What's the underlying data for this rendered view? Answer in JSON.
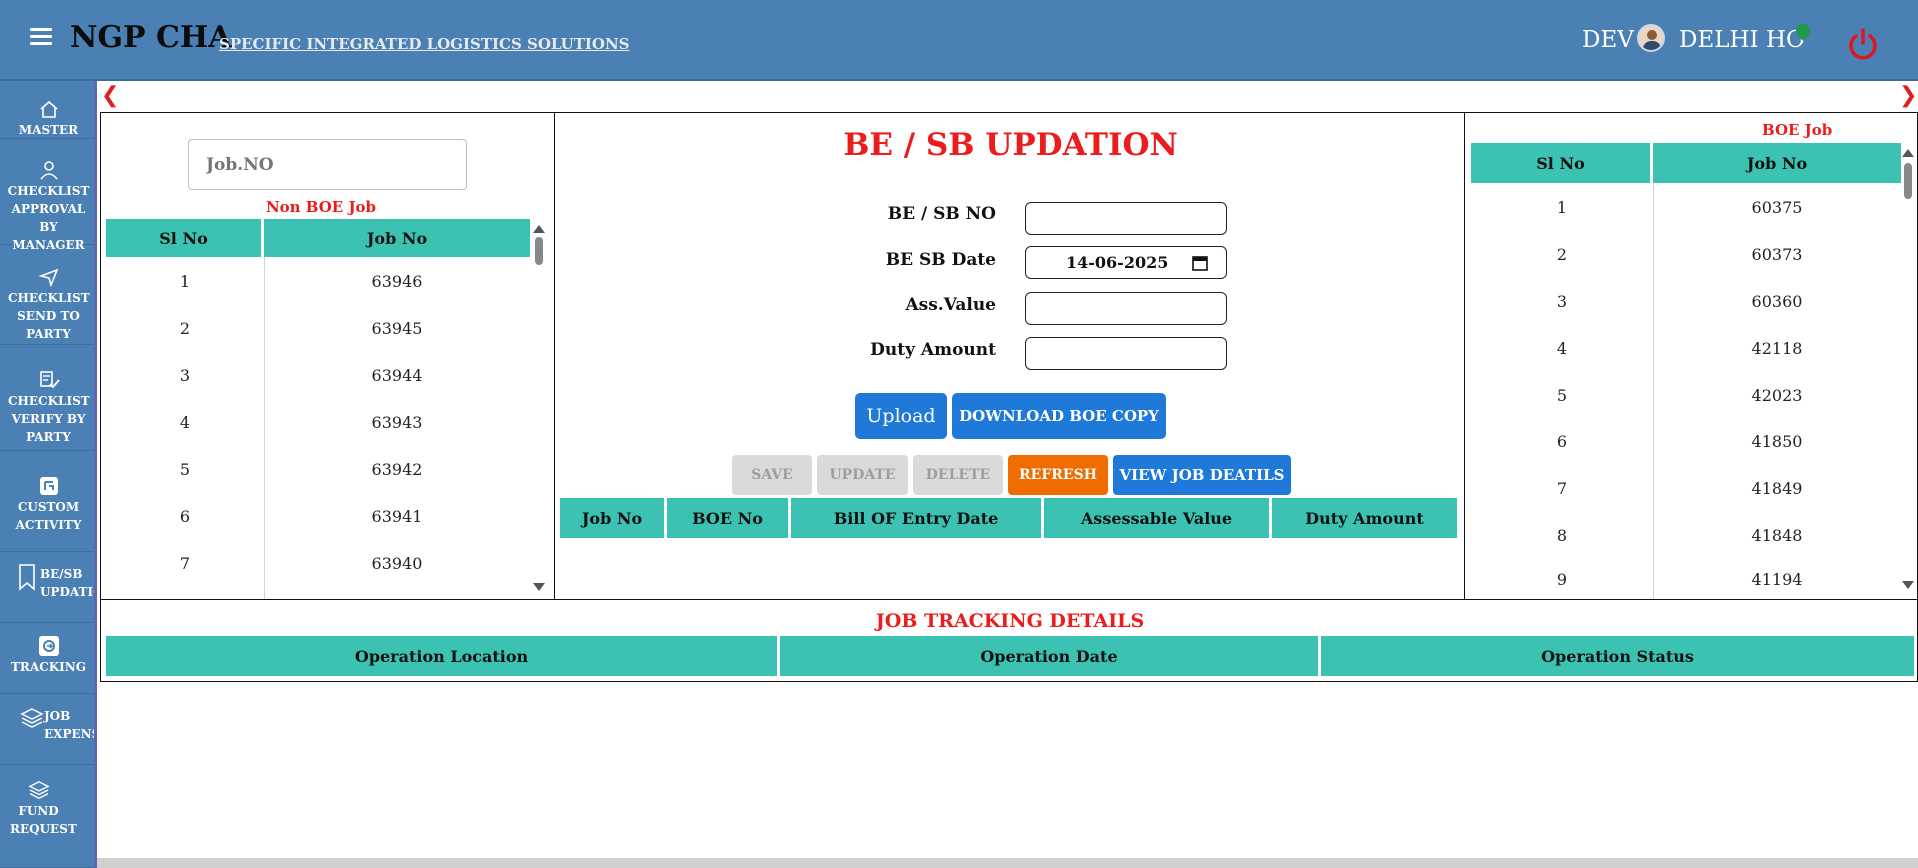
{
  "header": {
    "app_name": "NGP CHA",
    "tagline": "SPECIFIC INTEGRATED LOGISTICS SOLUTIONS",
    "user": "DEV",
    "branch": "DELHI HO"
  },
  "sidebar": {
    "items": [
      {
        "label": "MASTER",
        "icon": "home-icon"
      },
      {
        "label": "CHECKLIST APPROVAL BY MANAGER",
        "icon": "user-icon"
      },
      {
        "label": "CHECKLIST SEND TO PARTY",
        "icon": "send-icon"
      },
      {
        "label": "CHECKLIST VERIFY BY PARTY",
        "icon": "checklist-icon"
      },
      {
        "label": "CUSTOM ACTIVITY",
        "icon": "custom-icon"
      },
      {
        "label": "BE/SB UPDATION",
        "icon": "bookmark-icon"
      },
      {
        "label": "TRACKING",
        "icon": "tracking-icon"
      },
      {
        "label": "JOB EXPENSES",
        "icon": "layers-icon"
      },
      {
        "label": "FUND REQUEST",
        "icon": "layers-icon"
      }
    ]
  },
  "left_panel": {
    "search_placeholder": "Job.NO",
    "title": "Non BOE Job",
    "columns": [
      "Sl No",
      "Job No"
    ],
    "rows": [
      [
        "1",
        "63946"
      ],
      [
        "2",
        "63945"
      ],
      [
        "3",
        "63944"
      ],
      [
        "4",
        "63943"
      ],
      [
        "5",
        "63942"
      ],
      [
        "6",
        "63941"
      ],
      [
        "7",
        "63940"
      ]
    ]
  },
  "center_panel": {
    "title": "BE / SB UPDATION",
    "fields": {
      "be_sb_no_label": "BE / SB NO",
      "be_sb_no_value": "",
      "be_sb_date_label": "BE SB Date",
      "be_sb_date_value": "14-06-2025",
      "ass_value_label": "Ass.Value",
      "ass_value_value": "",
      "duty_amount_label": "Duty Amount",
      "duty_amount_value": ""
    },
    "buttons": {
      "upload": "Upload",
      "download": "DOWNLOAD BOE COPY",
      "save": "SAVE",
      "update": "UPDATE",
      "delete": "DELETE",
      "refresh": "REFRESH",
      "view": "VIEW JOB DEATILS"
    },
    "columns": [
      "Job No",
      "BOE No",
      "Bill OF Entry Date",
      "Assessable Value",
      "Duty Amount"
    ]
  },
  "right_panel": {
    "title": "BOE Job",
    "columns": [
      "Sl No",
      "Job No"
    ],
    "rows": [
      [
        "1",
        "60375"
      ],
      [
        "2",
        "60373"
      ],
      [
        "3",
        "60360"
      ],
      [
        "4",
        "42118"
      ],
      [
        "5",
        "42023"
      ],
      [
        "6",
        "41850"
      ],
      [
        "7",
        "41849"
      ],
      [
        "8",
        "41848"
      ],
      [
        "9",
        "41194"
      ]
    ]
  },
  "tracking": {
    "title": "JOB TRACKING DETAILS",
    "columns": [
      "Operation Location",
      "Operation Date",
      "Operation Status"
    ]
  },
  "colors": {
    "header": "#4a80b4",
    "teal": "#3bc2b2",
    "accent_red": "#ec1c1c",
    "blue_button": "#1e79d9",
    "orange_button": "#ef6c00"
  }
}
